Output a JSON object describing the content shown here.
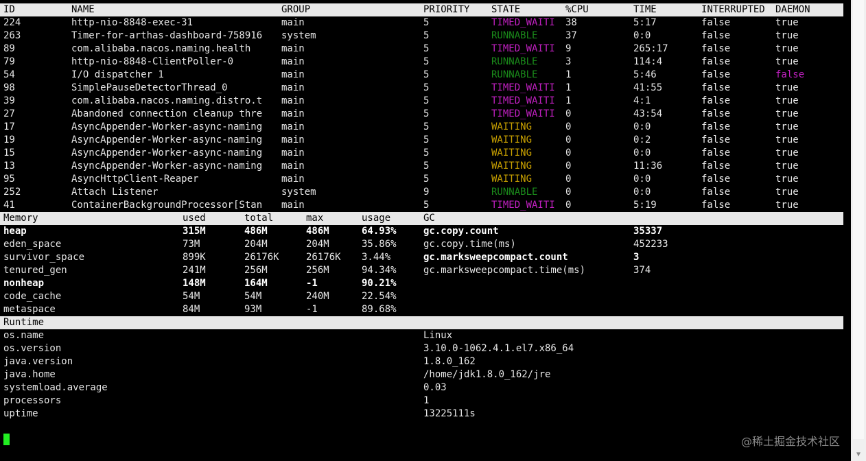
{
  "thread_headers": [
    "ID",
    "NAME",
    "GROUP",
    "PRIORITY",
    "STATE",
    "%CPU",
    "TIME",
    "INTERRUPTED",
    "DAEMON"
  ],
  "threads": [
    {
      "id": "224",
      "name": "http-nio-8848-exec-31",
      "group": "main",
      "priority": "5",
      "state": "TIMED_WAITI",
      "cpu": "38",
      "time": "5:17",
      "interrupted": "false",
      "daemon": "true"
    },
    {
      "id": "263",
      "name": "Timer-for-arthas-dashboard-758916",
      "group": "system",
      "priority": "5",
      "state": "RUNNABLE",
      "cpu": "37",
      "time": "0:0",
      "interrupted": "false",
      "daemon": "true"
    },
    {
      "id": "89",
      "name": "com.alibaba.nacos.naming.health",
      "group": "main",
      "priority": "5",
      "state": "TIMED_WAITI",
      "cpu": "9",
      "time": "265:17",
      "interrupted": "false",
      "daemon": "true"
    },
    {
      "id": "79",
      "name": "http-nio-8848-ClientPoller-0",
      "group": "main",
      "priority": "5",
      "state": "RUNNABLE",
      "cpu": "3",
      "time": "114:4",
      "interrupted": "false",
      "daemon": "true"
    },
    {
      "id": "54",
      "name": "I/O dispatcher 1",
      "group": "main",
      "priority": "5",
      "state": "RUNNABLE",
      "cpu": "1",
      "time": "5:46",
      "interrupted": "false",
      "daemon": "false"
    },
    {
      "id": "98",
      "name": "SimplePauseDetectorThread_0",
      "group": "main",
      "priority": "5",
      "state": "TIMED_WAITI",
      "cpu": "1",
      "time": "41:55",
      "interrupted": "false",
      "daemon": "true"
    },
    {
      "id": "39",
      "name": "com.alibaba.nacos.naming.distro.t",
      "group": "main",
      "priority": "5",
      "state": "TIMED_WAITI",
      "cpu": "1",
      "time": "4:1",
      "interrupted": "false",
      "daemon": "true"
    },
    {
      "id": "27",
      "name": "Abandoned connection cleanup thre",
      "group": "main",
      "priority": "5",
      "state": "TIMED_WAITI",
      "cpu": "0",
      "time": "43:54",
      "interrupted": "false",
      "daemon": "true"
    },
    {
      "id": "17",
      "name": "AsyncAppender-Worker-async-naming",
      "group": "main",
      "priority": "5",
      "state": "WAITING",
      "cpu": "0",
      "time": "0:0",
      "interrupted": "false",
      "daemon": "true"
    },
    {
      "id": "19",
      "name": "AsyncAppender-Worker-async-naming",
      "group": "main",
      "priority": "5",
      "state": "WAITING",
      "cpu": "0",
      "time": "0:2",
      "interrupted": "false",
      "daemon": "true"
    },
    {
      "id": "15",
      "name": "AsyncAppender-Worker-async-naming",
      "group": "main",
      "priority": "5",
      "state": "WAITING",
      "cpu": "0",
      "time": "0:0",
      "interrupted": "false",
      "daemon": "true"
    },
    {
      "id": "13",
      "name": "AsyncAppender-Worker-async-naming",
      "group": "main",
      "priority": "5",
      "state": "WAITING",
      "cpu": "0",
      "time": "11:36",
      "interrupted": "false",
      "daemon": "true"
    },
    {
      "id": "95",
      "name": "AsyncHttpClient-Reaper",
      "group": "main",
      "priority": "5",
      "state": "WAITING",
      "cpu": "0",
      "time": "0:0",
      "interrupted": "false",
      "daemon": "true"
    },
    {
      "id": "252",
      "name": "Attach Listener",
      "group": "system",
      "priority": "9",
      "state": "RUNNABLE",
      "cpu": "0",
      "time": "0:0",
      "interrupted": "false",
      "daemon": "true"
    },
    {
      "id": "41",
      "name": "ContainerBackgroundProcessor[Stan",
      "group": "main",
      "priority": "5",
      "state": "TIMED_WAITI",
      "cpu": "0",
      "time": "5:19",
      "interrupted": "false",
      "daemon": "true"
    }
  ],
  "memory_headers": [
    "Memory",
    "used",
    "total",
    "max",
    "usage",
    "GC"
  ],
  "memory": [
    {
      "name": "heap",
      "used": "315M",
      "total": "486M",
      "max": "486M",
      "usage": "64.93%",
      "bold": true
    },
    {
      "name": "eden_space",
      "used": "73M",
      "total": "204M",
      "max": "204M",
      "usage": "35.86%",
      "bold": false
    },
    {
      "name": "survivor_space",
      "used": "899K",
      "total": "26176K",
      "max": "26176K",
      "usage": "3.44%",
      "bold": false
    },
    {
      "name": "tenured_gen",
      "used": "241M",
      "total": "256M",
      "max": "256M",
      "usage": "94.34%",
      "bold": false
    },
    {
      "name": "nonheap",
      "used": "148M",
      "total": "164M",
      "max": "-1",
      "usage": "90.21%",
      "bold": true
    },
    {
      "name": "code_cache",
      "used": "54M",
      "total": "54M",
      "max": "240M",
      "usage": "22.54%",
      "bold": false
    },
    {
      "name": "metaspace",
      "used": "84M",
      "total": "93M",
      "max": "-1",
      "usage": "89.68%",
      "bold": false
    }
  ],
  "gc": [
    {
      "name": "gc.copy.count",
      "value": "35337",
      "bold": true
    },
    {
      "name": "gc.copy.time(ms)",
      "value": "452233",
      "bold": false
    },
    {
      "name": "gc.marksweepcompact.count",
      "value": "3",
      "bold": true
    },
    {
      "name": "gc.marksweepcompact.time(ms)",
      "value": "374",
      "bold": false
    }
  ],
  "runtime_header": "Runtime",
  "runtime": [
    {
      "key": "os.name",
      "value": "Linux"
    },
    {
      "key": "os.version",
      "value": "3.10.0-1062.4.1.el7.x86_64"
    },
    {
      "key": "java.version",
      "value": "1.8.0_162"
    },
    {
      "key": "java.home",
      "value": "/home/jdk1.8.0_162/jre"
    },
    {
      "key": "systemload.average",
      "value": "0.03"
    },
    {
      "key": "processors",
      "value": "1"
    },
    {
      "key": "uptime",
      "value": "13225111s"
    }
  ],
  "state_colors": {
    "TIMED_WAITI": "#c020c0",
    "RUNNABLE": "#1a8a1a",
    "WAITING": "#c8a000"
  },
  "watermark": "@稀土掘金技术社区",
  "scroll_arrow": "▼"
}
